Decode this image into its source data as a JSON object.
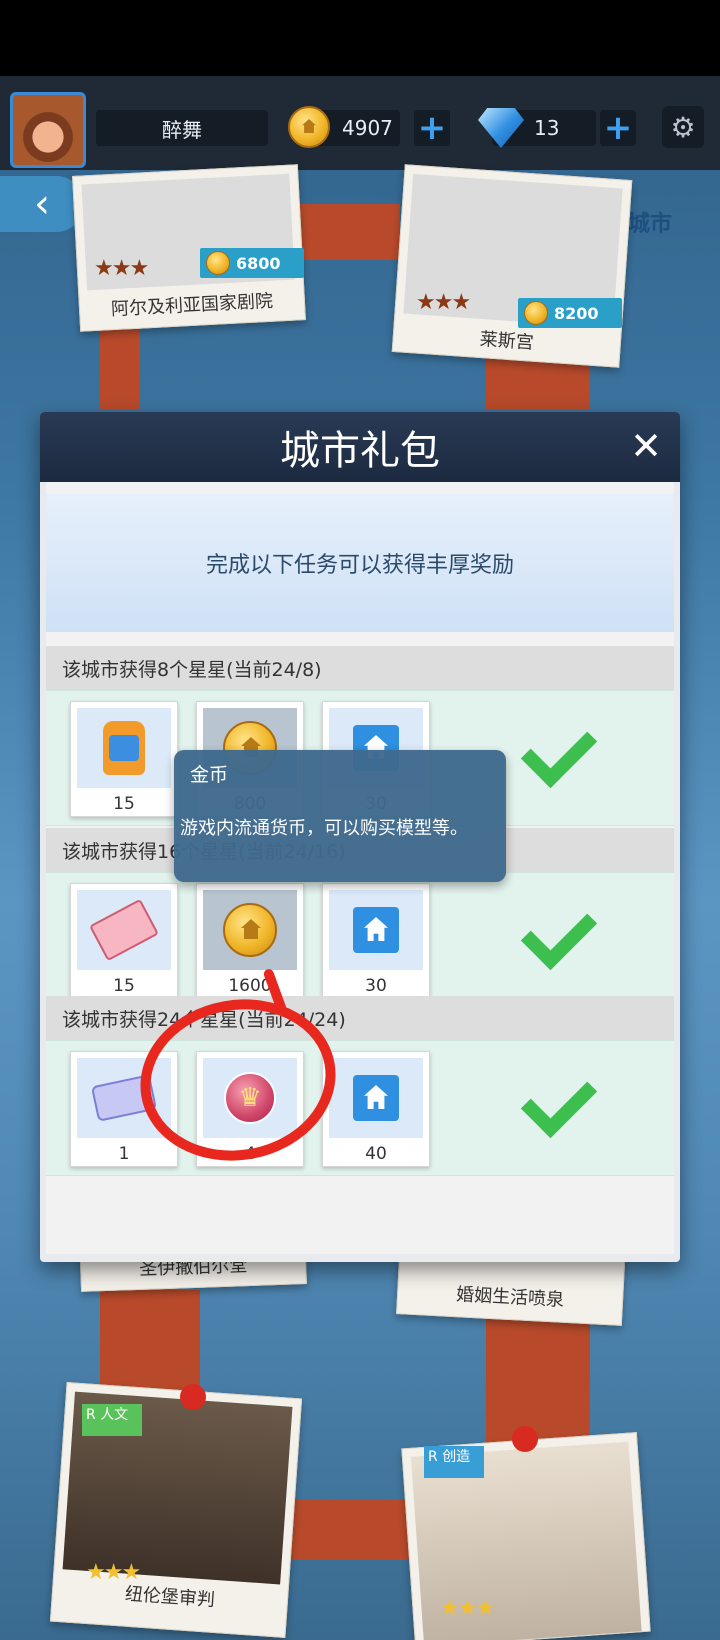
{
  "topbar": {
    "player_name": "醉舞",
    "coins": "4907",
    "gems": "13",
    "plus_symbol": "+",
    "gear_glyph": "⚙"
  },
  "nav": {
    "back_glyph": "‹",
    "switch_city_label": "切换城市"
  },
  "background_cards": [
    {
      "title": "阿尔及利亚国家剧院",
      "price": "6800",
      "stars": "★★★"
    },
    {
      "title": "莱斯宫",
      "price": "8200",
      "stars": "★★★"
    },
    {
      "title": "圣伊撒伯尔堂"
    },
    {
      "title": "婚姻生活喷泉",
      "stars": "★★★"
    },
    {
      "title": "纽伦堡审判",
      "badge": "人文",
      "rank": "R",
      "stars": "★★★"
    },
    {
      "badge": "创造",
      "rank": "R",
      "stars": "★★★"
    }
  ],
  "modal": {
    "title": "城市礼包",
    "close_glyph": "✕",
    "banner_text": "完成以下任务可以获得丰厚奖励",
    "sections": [
      {
        "title": "该城市获得8个星星(当前24/8)",
        "rewards": [
          {
            "icon": "backpack-icon",
            "qty": "15"
          },
          {
            "icon": "coin-icon",
            "qty": "800"
          },
          {
            "icon": "house-icon",
            "qty": "30"
          }
        ]
      },
      {
        "title": "该城市获得16个星星(当前24/16)",
        "rewards": [
          {
            "icon": "book-icon",
            "qty": "15"
          },
          {
            "icon": "coin-icon",
            "qty": "1600"
          },
          {
            "icon": "house-icon",
            "qty": "30"
          }
        ]
      },
      {
        "title": "该城市获得24个星星(当前24/24)",
        "rewards": [
          {
            "icon": "ticket-icon",
            "qty": "1"
          },
          {
            "icon": "crown-medal-icon",
            "qty": "4"
          },
          {
            "icon": "house-icon",
            "qty": "40"
          }
        ]
      }
    ]
  },
  "tooltip": {
    "title": "金币",
    "description": "游戏内流通货币，可以购买模型等。"
  },
  "colors": {
    "accent_blue": "#2f8fe0",
    "check_green": "#3dbf4f",
    "annotation_red": "#e8281e"
  }
}
